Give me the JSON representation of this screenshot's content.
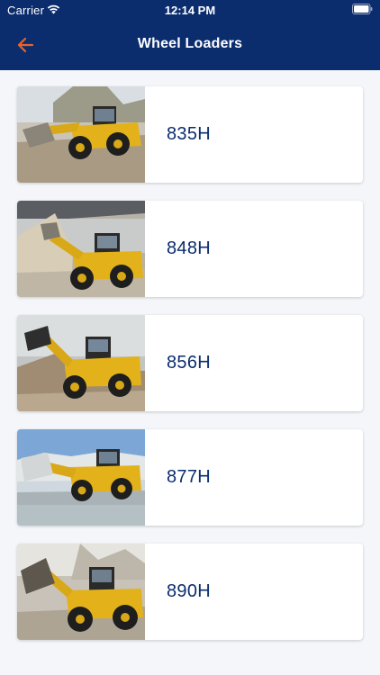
{
  "status_bar": {
    "carrier": "Carrier",
    "time": "12:14 PM"
  },
  "header": {
    "title": "Wheel Loaders",
    "back_icon": "arrow-left-icon"
  },
  "colors": {
    "header_bg": "#0B2D6E",
    "accent": "#E8642B",
    "model_text": "#0B2D6E",
    "page_bg": "#F4F6FA"
  },
  "loaders": [
    {
      "model": "835H"
    },
    {
      "model": "848H"
    },
    {
      "model": "856H"
    },
    {
      "model": "877H"
    },
    {
      "model": "890H"
    }
  ]
}
